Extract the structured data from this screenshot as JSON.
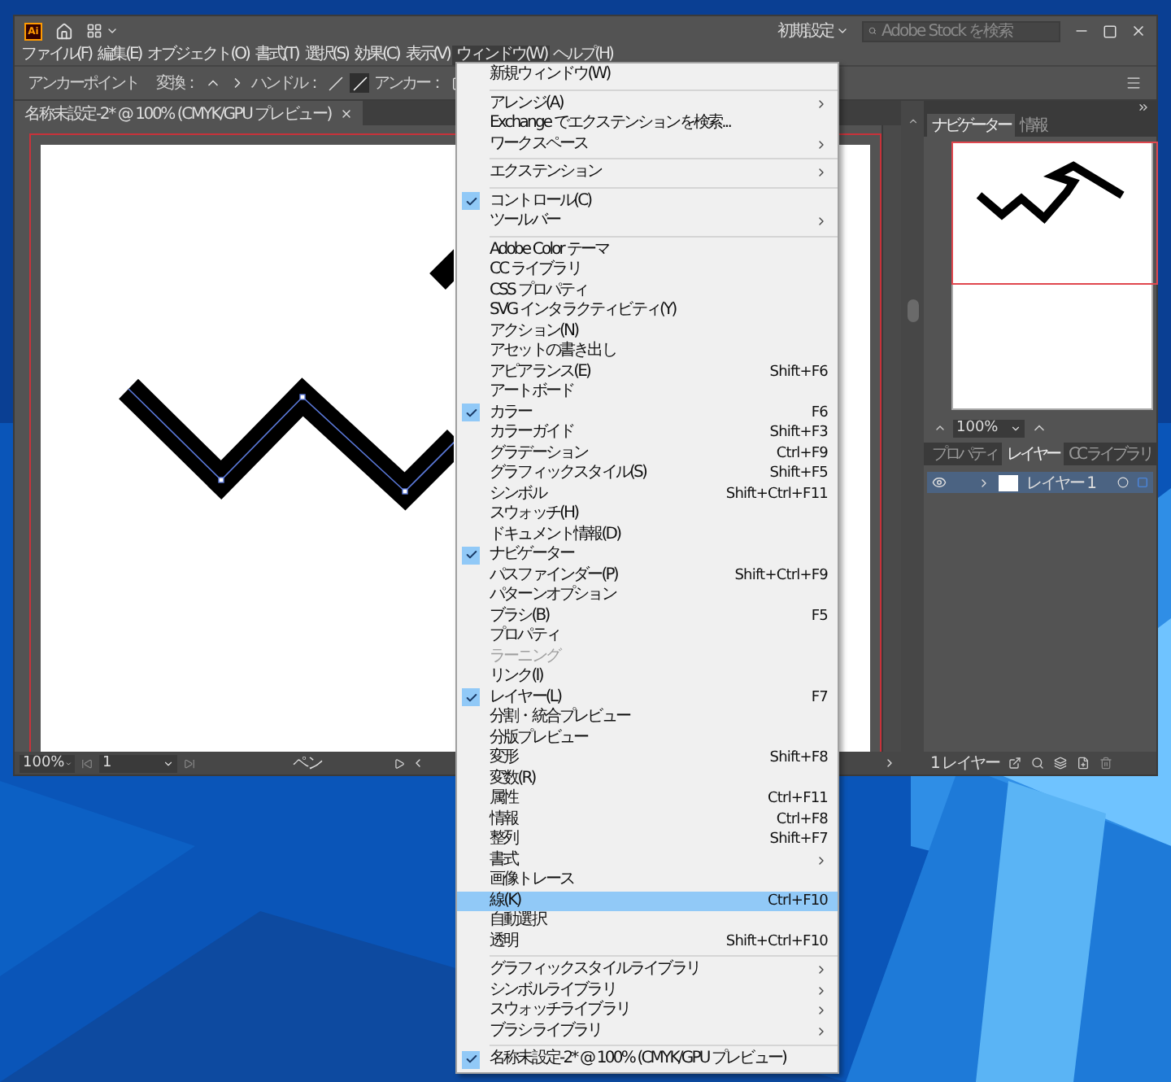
{
  "app": {
    "logo": "Ai",
    "workspace": "初期設定",
    "search": {
      "placeholder": "Adobe Stock を検索"
    }
  },
  "menubar": [
    {
      "label": "ファイル(F)",
      "selected": false
    },
    {
      "label": "編集(E)",
      "selected": false
    },
    {
      "label": "オブジェクト(O)",
      "selected": false
    },
    {
      "label": "書式(T)",
      "selected": false
    },
    {
      "label": "選択(S)",
      "selected": false
    },
    {
      "label": "効果(C)",
      "selected": false
    },
    {
      "label": "表示(V)",
      "selected": false
    },
    {
      "label": "ウィンドウ(W)",
      "selected": true
    },
    {
      "label": "ヘルプ(H)",
      "selected": false
    }
  ],
  "control_bar": {
    "tool": "アンカーポイント",
    "convert_label": "変換：",
    "handle_label": "ハンドル：",
    "anchor_label": "アンカー："
  },
  "document_tab": {
    "title": "名称未設定-2* @ 100% (CMYK/GPU プレビュー)"
  },
  "status_bar": {
    "zoom": "100%",
    "artboard": "1",
    "tool": "ペン"
  },
  "navigator": {
    "tabs": [
      {
        "label": "ナビゲーター",
        "selected": true
      },
      {
        "label": "情報",
        "selected": false
      }
    ],
    "zoom": "100%"
  },
  "layers_panel": {
    "tabs": [
      {
        "label": "プロパティ",
        "selected": false
      },
      {
        "label": "レイヤー",
        "selected": true
      },
      {
        "label": "CC ライブラリ",
        "selected": false
      }
    ],
    "layers": [
      {
        "name": "レイヤー 1",
        "visible": true
      }
    ],
    "count": "1 レイヤー"
  },
  "window_menu": {
    "items": [
      {
        "kind": "item",
        "label": "新規ウィンドウ(W)",
        "checked": false,
        "selected": false,
        "submenu": false,
        "disabled": false
      },
      {
        "kind": "separator"
      },
      {
        "kind": "item",
        "label": "アレンジ(A)",
        "checked": false,
        "selected": false,
        "submenu": true,
        "disabled": false
      },
      {
        "kind": "item",
        "label": "Exchange でエクステンションを検索...",
        "checked": false,
        "selected": false,
        "submenu": false,
        "disabled": false
      },
      {
        "kind": "item",
        "label": "ワークスペース",
        "checked": false,
        "selected": false,
        "submenu": true,
        "disabled": false
      },
      {
        "kind": "separator"
      },
      {
        "kind": "item",
        "label": "エクステンション",
        "checked": false,
        "selected": false,
        "submenu": true,
        "disabled": false
      },
      {
        "kind": "separator"
      },
      {
        "kind": "item",
        "label": "コントロール(C)",
        "checked": true,
        "selected": false,
        "submenu": false,
        "disabled": false
      },
      {
        "kind": "item",
        "label": "ツールバー",
        "checked": false,
        "selected": false,
        "submenu": true,
        "disabled": false
      },
      {
        "kind": "separator"
      },
      {
        "kind": "item",
        "label": "Adobe Color テーマ",
        "checked": false,
        "selected": false,
        "submenu": false,
        "disabled": false
      },
      {
        "kind": "item",
        "label": "CC ライブラリ",
        "checked": false,
        "selected": false,
        "submenu": false,
        "disabled": false
      },
      {
        "kind": "item",
        "label": "CSS プロパティ",
        "checked": false,
        "selected": false,
        "submenu": false,
        "disabled": false
      },
      {
        "kind": "item",
        "label": "SVG インタラクティビティ(Y)",
        "checked": false,
        "selected": false,
        "submenu": false,
        "disabled": false
      },
      {
        "kind": "item",
        "label": "アクション(N)",
        "checked": false,
        "selected": false,
        "submenu": false,
        "disabled": false
      },
      {
        "kind": "item",
        "label": "アセットの書き出し",
        "checked": false,
        "selected": false,
        "submenu": false,
        "disabled": false
      },
      {
        "kind": "item",
        "label": "アピアランス(E)",
        "shortcut": "Shift+F6",
        "checked": false,
        "selected": false,
        "submenu": false,
        "disabled": false
      },
      {
        "kind": "item",
        "label": "アートボード",
        "checked": false,
        "selected": false,
        "submenu": false,
        "disabled": false
      },
      {
        "kind": "item",
        "label": "カラー",
        "shortcut": "F6",
        "checked": true,
        "selected": false,
        "submenu": false,
        "disabled": false
      },
      {
        "kind": "item",
        "label": "カラーガイド",
        "shortcut": "Shift+F3",
        "checked": false,
        "selected": false,
        "submenu": false,
        "disabled": false
      },
      {
        "kind": "item",
        "label": "グラデーション",
        "shortcut": "Ctrl+F9",
        "checked": false,
        "selected": false,
        "submenu": false,
        "disabled": false
      },
      {
        "kind": "item",
        "label": "グラフィックスタイル(S)",
        "shortcut": "Shift+F5",
        "checked": false,
        "selected": false,
        "submenu": false,
        "disabled": false
      },
      {
        "kind": "item",
        "label": "シンボル",
        "shortcut": "Shift+Ctrl+F11",
        "checked": false,
        "selected": false,
        "submenu": false,
        "disabled": false
      },
      {
        "kind": "item",
        "label": "スウォッチ(H)",
        "checked": false,
        "selected": false,
        "submenu": false,
        "disabled": false
      },
      {
        "kind": "item",
        "label": "ドキュメント情報(D)",
        "checked": false,
        "selected": false,
        "submenu": false,
        "disabled": false
      },
      {
        "kind": "item",
        "label": "ナビゲーター",
        "checked": true,
        "selected": false,
        "submenu": false,
        "disabled": false
      },
      {
        "kind": "item",
        "label": "パスファインダー(P)",
        "shortcut": "Shift+Ctrl+F9",
        "checked": false,
        "selected": false,
        "submenu": false,
        "disabled": false
      },
      {
        "kind": "item",
        "label": "パターンオプション",
        "checked": false,
        "selected": false,
        "submenu": false,
        "disabled": false
      },
      {
        "kind": "item",
        "label": "ブラシ(B)",
        "shortcut": "F5",
        "checked": false,
        "selected": false,
        "submenu": false,
        "disabled": false
      },
      {
        "kind": "item",
        "label": "プロパティ",
        "checked": false,
        "selected": false,
        "submenu": false,
        "disabled": false
      },
      {
        "kind": "item",
        "label": "ラーニング",
        "checked": false,
        "selected": false,
        "submenu": false,
        "disabled": true
      },
      {
        "kind": "item",
        "label": "リンク(I)",
        "checked": false,
        "selected": false,
        "submenu": false,
        "disabled": false
      },
      {
        "kind": "item",
        "label": "レイヤー(L)",
        "shortcut": "F7",
        "checked": true,
        "selected": false,
        "submenu": false,
        "disabled": false
      },
      {
        "kind": "item",
        "label": "分割・統合プレビュー",
        "checked": false,
        "selected": false,
        "submenu": false,
        "disabled": false
      },
      {
        "kind": "item",
        "label": "分版プレビュー",
        "checked": false,
        "selected": false,
        "submenu": false,
        "disabled": false
      },
      {
        "kind": "item",
        "label": "変形",
        "shortcut": "Shift+F8",
        "checked": false,
        "selected": false,
        "submenu": false,
        "disabled": false
      },
      {
        "kind": "item",
        "label": "変数(R)",
        "checked": false,
        "selected": false,
        "submenu": false,
        "disabled": false
      },
      {
        "kind": "item",
        "label": "属性",
        "shortcut": "Ctrl+F11",
        "checked": false,
        "selected": false,
        "submenu": false,
        "disabled": false
      },
      {
        "kind": "item",
        "label": "情報",
        "shortcut": "Ctrl+F8",
        "checked": false,
        "selected": false,
        "submenu": false,
        "disabled": false
      },
      {
        "kind": "item",
        "label": "整列",
        "shortcut": "Shift+F7",
        "checked": false,
        "selected": false,
        "submenu": false,
        "disabled": false
      },
      {
        "kind": "item",
        "label": "書式",
        "checked": false,
        "selected": false,
        "submenu": true,
        "disabled": false
      },
      {
        "kind": "item",
        "label": "画像トレース",
        "checked": false,
        "selected": false,
        "submenu": false,
        "disabled": false
      },
      {
        "kind": "item",
        "label": "線(K)",
        "shortcut": "Ctrl+F10",
        "checked": false,
        "selected": true,
        "submenu": false,
        "disabled": false
      },
      {
        "kind": "item",
        "label": "自動選択",
        "checked": false,
        "selected": false,
        "submenu": false,
        "disabled": false
      },
      {
        "kind": "item",
        "label": "透明",
        "shortcut": "Shift+Ctrl+F10",
        "checked": false,
        "selected": false,
        "submenu": false,
        "disabled": false
      },
      {
        "kind": "separator"
      },
      {
        "kind": "item",
        "label": "グラフィックスタイルライブラリ",
        "checked": false,
        "selected": false,
        "submenu": true,
        "disabled": false
      },
      {
        "kind": "item",
        "label": "シンボルライブラリ",
        "checked": false,
        "selected": false,
        "submenu": true,
        "disabled": false
      },
      {
        "kind": "item",
        "label": "スウォッチライブラリ",
        "checked": false,
        "selected": false,
        "submenu": true,
        "disabled": false
      },
      {
        "kind": "item",
        "label": "ブラシライブラリ",
        "checked": false,
        "selected": false,
        "submenu": true,
        "disabled": false
      },
      {
        "kind": "separator"
      },
      {
        "kind": "item",
        "label": "名称未設定-2* @ 100% (CMYK/GPU プレビュー)",
        "checked": true,
        "selected": false,
        "submenu": false,
        "disabled": false
      }
    ]
  }
}
